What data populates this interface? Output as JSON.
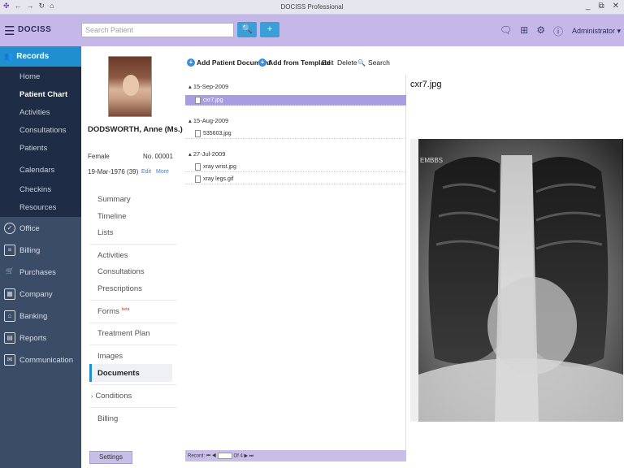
{
  "titlebar": {
    "title": "DOCISS Professional",
    "controls": [
      "_",
      "⧉",
      "✕"
    ]
  },
  "header": {
    "brand": "DOCISS",
    "search_placeholder": "Search Patient",
    "search_button": "🔍",
    "add_button": "+",
    "user": "Administrator ▾"
  },
  "leftnav": {
    "active": "Records",
    "sub_items": [
      "Home",
      "Patient Chart",
      "Activities",
      "Consultations",
      "Patients",
      "Calendars",
      "Checkins",
      "Resources"
    ],
    "active_sub": "Patient Chart",
    "main_items": [
      "Office",
      "Billing",
      "Purchases",
      "Company",
      "Banking",
      "Reports",
      "Communication"
    ]
  },
  "patient": {
    "name": "DODSWORTH, Anne (Ms.)",
    "sex": "Female",
    "number": "No. 00001",
    "dob": "19-Mar-1976 (39)",
    "edit": "Edit",
    "more": "More",
    "nav_group1": [
      "Summary",
      "Timeline",
      "Lists"
    ],
    "nav_group2": [
      "Activities",
      "Consultations",
      "Prescriptions"
    ],
    "forms": "Forms",
    "forms_badge": "beta",
    "treatment_plan": "Treatment Plan",
    "images": "Images",
    "documents": "Documents",
    "conditions": "Conditions",
    "billing": "Billing",
    "settings": "Settings"
  },
  "toolbar": {
    "add_patient_document": "Add Patient Document",
    "add_from_template": "Add from Template",
    "edit": "Edit",
    "delete": "Delete",
    "search": "Search"
  },
  "documents": {
    "groups": [
      {
        "date": "15-Sep-2009",
        "files": [
          "cxr7.jpg"
        ]
      },
      {
        "date": "15-Aug-2009",
        "files": [
          "535603.jpg"
        ]
      },
      {
        "date": "27-Jul-2009",
        "files": [
          "xray wrist.jpg",
          "xray legs.gif"
        ]
      }
    ],
    "selected": "cxr7.jpg"
  },
  "pager": {
    "label": "Record:",
    "page": "1",
    "of": "Of 4"
  },
  "preview": {
    "title": "cxr7.jpg",
    "image_mark": "EMBBS"
  }
}
